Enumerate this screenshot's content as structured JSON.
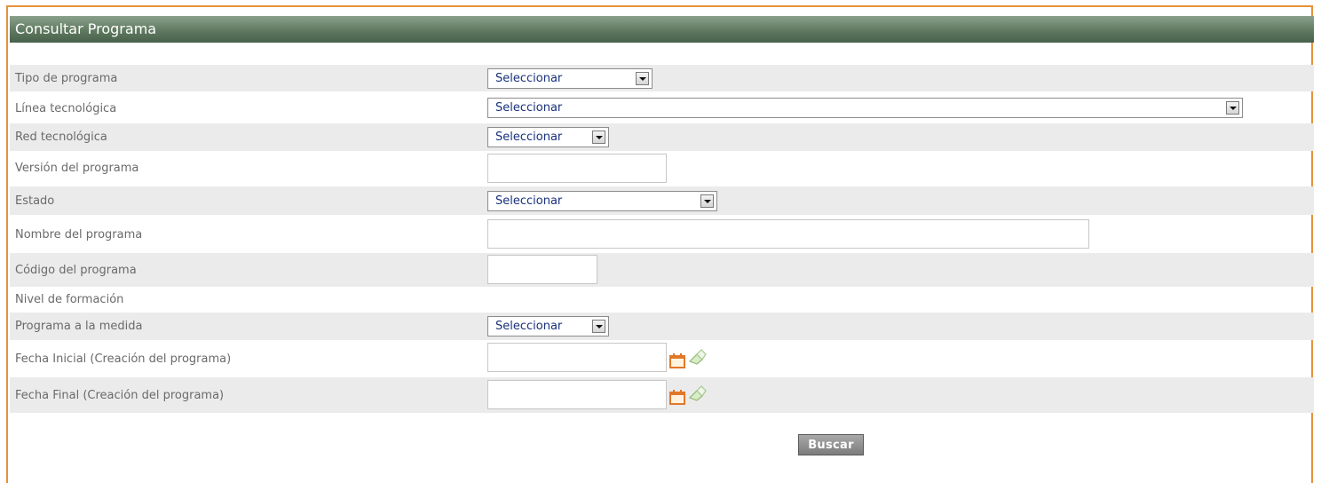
{
  "panel": {
    "title": "Consultar Programa"
  },
  "form": {
    "tipo_programa": {
      "label": "Tipo de programa",
      "value": "Seleccionar"
    },
    "linea_tecnologica": {
      "label": "Línea tecnológica",
      "value": "Seleccionar"
    },
    "red_tecnologica": {
      "label": "Red tecnológica",
      "value": "Seleccionar"
    },
    "version_programa": {
      "label": "Versión del programa",
      "value": ""
    },
    "estado": {
      "label": "Estado",
      "value": "Seleccionar"
    },
    "nombre_programa": {
      "label": "Nombre del programa",
      "value": ""
    },
    "codigo_programa": {
      "label": "Código del programa",
      "value": ""
    },
    "nivel_formacion": {
      "label": "Nivel de formación"
    },
    "programa_medida": {
      "label": "Programa a la medida",
      "value": "Seleccionar"
    },
    "fecha_inicial": {
      "label": "Fecha Inicial (Creación del programa)",
      "value": ""
    },
    "fecha_final": {
      "label": "Fecha Final (Creación del programa)",
      "value": ""
    }
  },
  "icons": {
    "calendar": "calendar-icon",
    "clear": "clear-date-icon"
  },
  "colors": {
    "accent_border": "#e8913a",
    "title_bar": "#5f7a60",
    "row_shade": "#ebebeb"
  },
  "actions": {
    "search_label": "Buscar"
  }
}
